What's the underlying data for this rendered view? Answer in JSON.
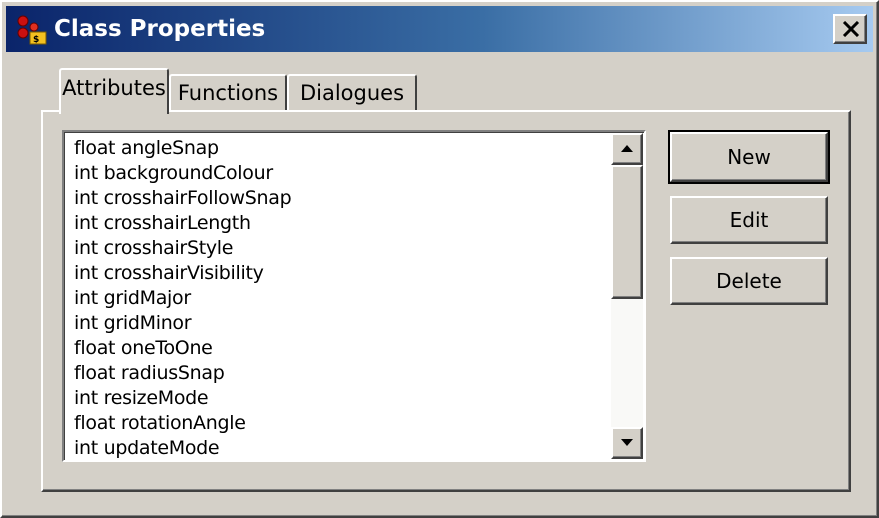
{
  "window": {
    "title": "Class Properties",
    "app_icon": "class-properties-icon",
    "close_icon": "close-icon"
  },
  "tabs": [
    {
      "label": "Attributes",
      "active": true
    },
    {
      "label": "Functions",
      "active": false
    },
    {
      "label": "Dialogues",
      "active": false
    }
  ],
  "attributes_list": {
    "items": [
      "float angleSnap",
      "int backgroundColour",
      "int crosshairFollowSnap",
      "int crosshairLength",
      "int crosshairStyle",
      "int crosshairVisibility",
      "int gridMajor",
      "int gridMinor",
      "float oneToOne",
      "float radiusSnap",
      "int resizeMode",
      "float rotationAngle",
      "int updateMode"
    ]
  },
  "buttons": {
    "new_label": "New",
    "edit_label": "Edit",
    "delete_label": "Delete"
  },
  "colors": {
    "titlebar_start": "#0a246a",
    "titlebar_end": "#a6caf0",
    "face": "#d4d0c8"
  }
}
